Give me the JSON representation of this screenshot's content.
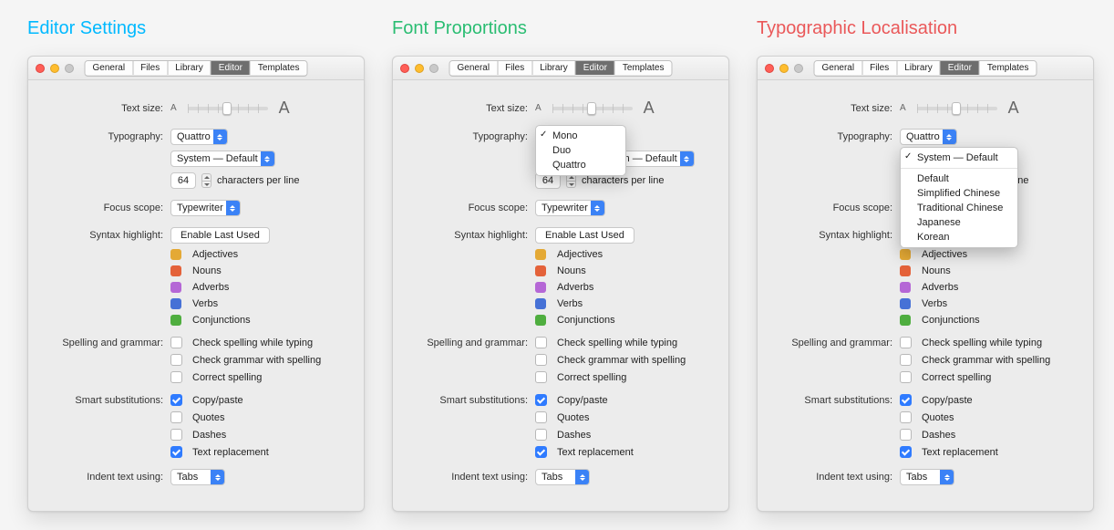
{
  "columns": [
    {
      "title": "Editor Settings",
      "title_class": "t-blue"
    },
    {
      "title": "Font Proportions",
      "title_class": "t-green"
    },
    {
      "title": "Typographic Localisation",
      "title_class": "t-red"
    }
  ],
  "tabs": [
    "General",
    "Files",
    "Library",
    "Editor",
    "Templates"
  ],
  "active_tab": "Editor",
  "labels": {
    "text_size": "Text size:",
    "typography": "Typography:",
    "cpl_suffix": "characters per line",
    "focus_scope": "Focus scope:",
    "syntax_highlight": "Syntax highlight:",
    "spelling": "Spelling and grammar:",
    "smart_sub": "Smart substitutions:",
    "indent": "Indent text using:"
  },
  "values": {
    "typography_selected": "Quattro",
    "system_selected": "System — Default",
    "cpl": "64",
    "focus_scope": "Typewriter",
    "syntax_button": "Enable Last Used",
    "indent": "Tabs"
  },
  "syntax_tags": [
    {
      "label": "Adjectives",
      "class": "c-adj"
    },
    {
      "label": "Nouns",
      "class": "c-noun"
    },
    {
      "label": "Adverbs",
      "class": "c-adv"
    },
    {
      "label": "Verbs",
      "class": "c-verb"
    },
    {
      "label": "Conjunctions",
      "class": "c-conj"
    }
  ],
  "spelling_opts": [
    {
      "label": "Check spelling while typing",
      "checked": false
    },
    {
      "label": "Check grammar with spelling",
      "checked": false
    },
    {
      "label": "Correct spelling",
      "checked": false
    }
  ],
  "smart_opts": [
    {
      "label": "Copy/paste",
      "checked": true
    },
    {
      "label": "Quotes",
      "checked": false
    },
    {
      "label": "Dashes",
      "checked": false
    },
    {
      "label": "Text replacement",
      "checked": true
    }
  ],
  "typography_dropdown": {
    "options": [
      "Mono",
      "Duo",
      "Quattro"
    ],
    "selected": "Mono"
  },
  "system_dropdown": {
    "selected": "System — Default",
    "groups": [
      [
        "System — Default"
      ],
      [
        "Default",
        "Simplified Chinese",
        "Traditional Chinese",
        "Japanese",
        "Korean"
      ]
    ]
  }
}
